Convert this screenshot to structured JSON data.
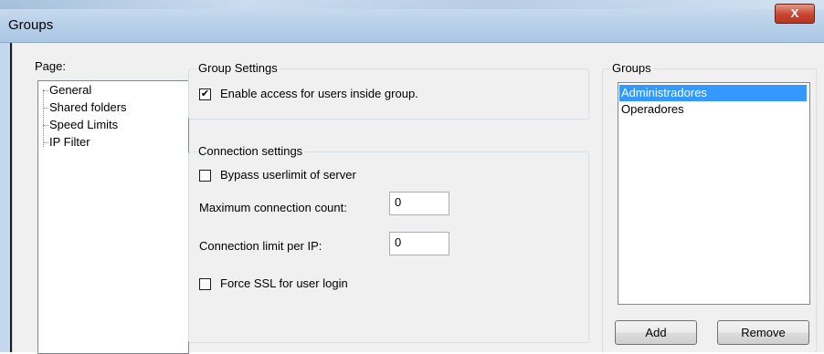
{
  "window": {
    "title": "Groups",
    "close_glyph": "X"
  },
  "page": {
    "label": "Page:",
    "tree": [
      "General",
      "Shared folders",
      "Speed Limits",
      "IP Filter"
    ]
  },
  "group_settings": {
    "legend": "Group Settings",
    "enable_access": {
      "label": "Enable access for users inside group.",
      "checked": true
    }
  },
  "connection_settings": {
    "legend": "Connection settings",
    "bypass": {
      "label": "Bypass userlimit of server",
      "checked": false
    },
    "max_conn": {
      "label": "Maximum connection count:",
      "value": "0"
    },
    "limit_ip": {
      "label": "Connection limit per IP:",
      "value": "0"
    },
    "force_ssl": {
      "label": "Force SSL for user login",
      "checked": false
    }
  },
  "groups": {
    "legend": "Groups",
    "items": [
      "Administradores",
      "Operadores"
    ],
    "selected_index": 0,
    "add_label": "Add",
    "remove_label": "Remove"
  },
  "colors": {
    "selection": "#3399ff",
    "close_button": "#c8432e"
  }
}
